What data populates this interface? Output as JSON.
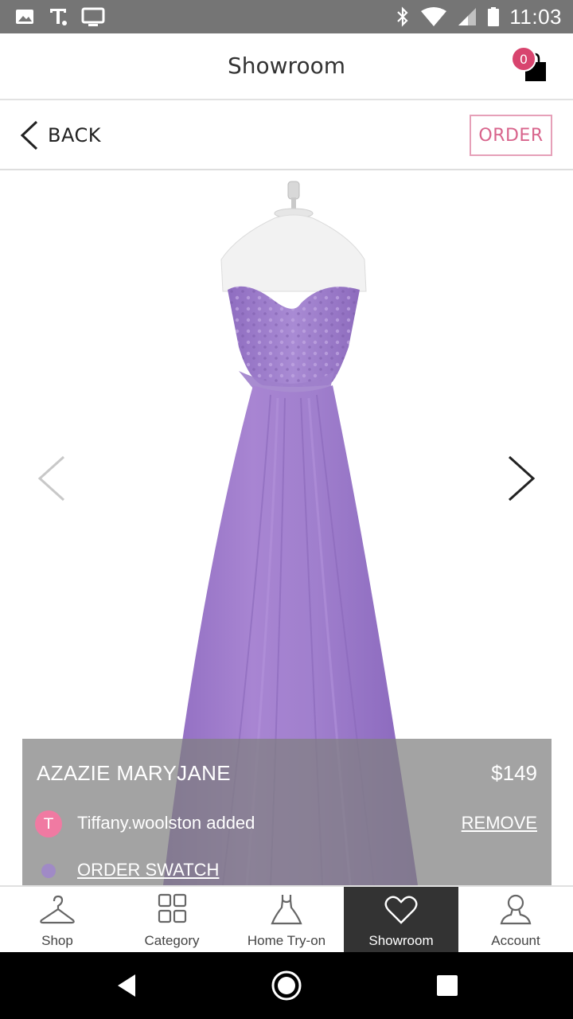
{
  "status_bar": {
    "time": "11:03",
    "left_icons": [
      "image-icon",
      "t-mobile-icon",
      "cast-icon"
    ],
    "right_icons": [
      "bluetooth-icon",
      "wifi-icon",
      "signal-icon",
      "battery-icon"
    ]
  },
  "header": {
    "title": "Showroom",
    "cart_count": "0"
  },
  "sub_header": {
    "back_label": "BACK",
    "order_label": "ORDER"
  },
  "product": {
    "name": "AZAZIE MARYJANE",
    "price": "$149",
    "color": "#a080c8",
    "added_by_initial": "T",
    "added_by_text": "Tiffany.woolston added",
    "remove_label": "REMOVE",
    "swatch_label": "ORDER SWATCH"
  },
  "bottom_nav": {
    "items": [
      {
        "label": "Shop",
        "icon": "hanger-icon"
      },
      {
        "label": "Category",
        "icon": "grid-icon"
      },
      {
        "label": "Home Try-on",
        "icon": "dress-icon"
      },
      {
        "label": "Showroom",
        "icon": "heart-icon"
      },
      {
        "label": "Account",
        "icon": "user-icon"
      }
    ],
    "active": "Showroom"
  },
  "colors": {
    "accent_pink": "#d8446e",
    "order_border": "#e6a0b8",
    "nav_active_bg": "#333333",
    "status_bar_bg": "#757575"
  }
}
